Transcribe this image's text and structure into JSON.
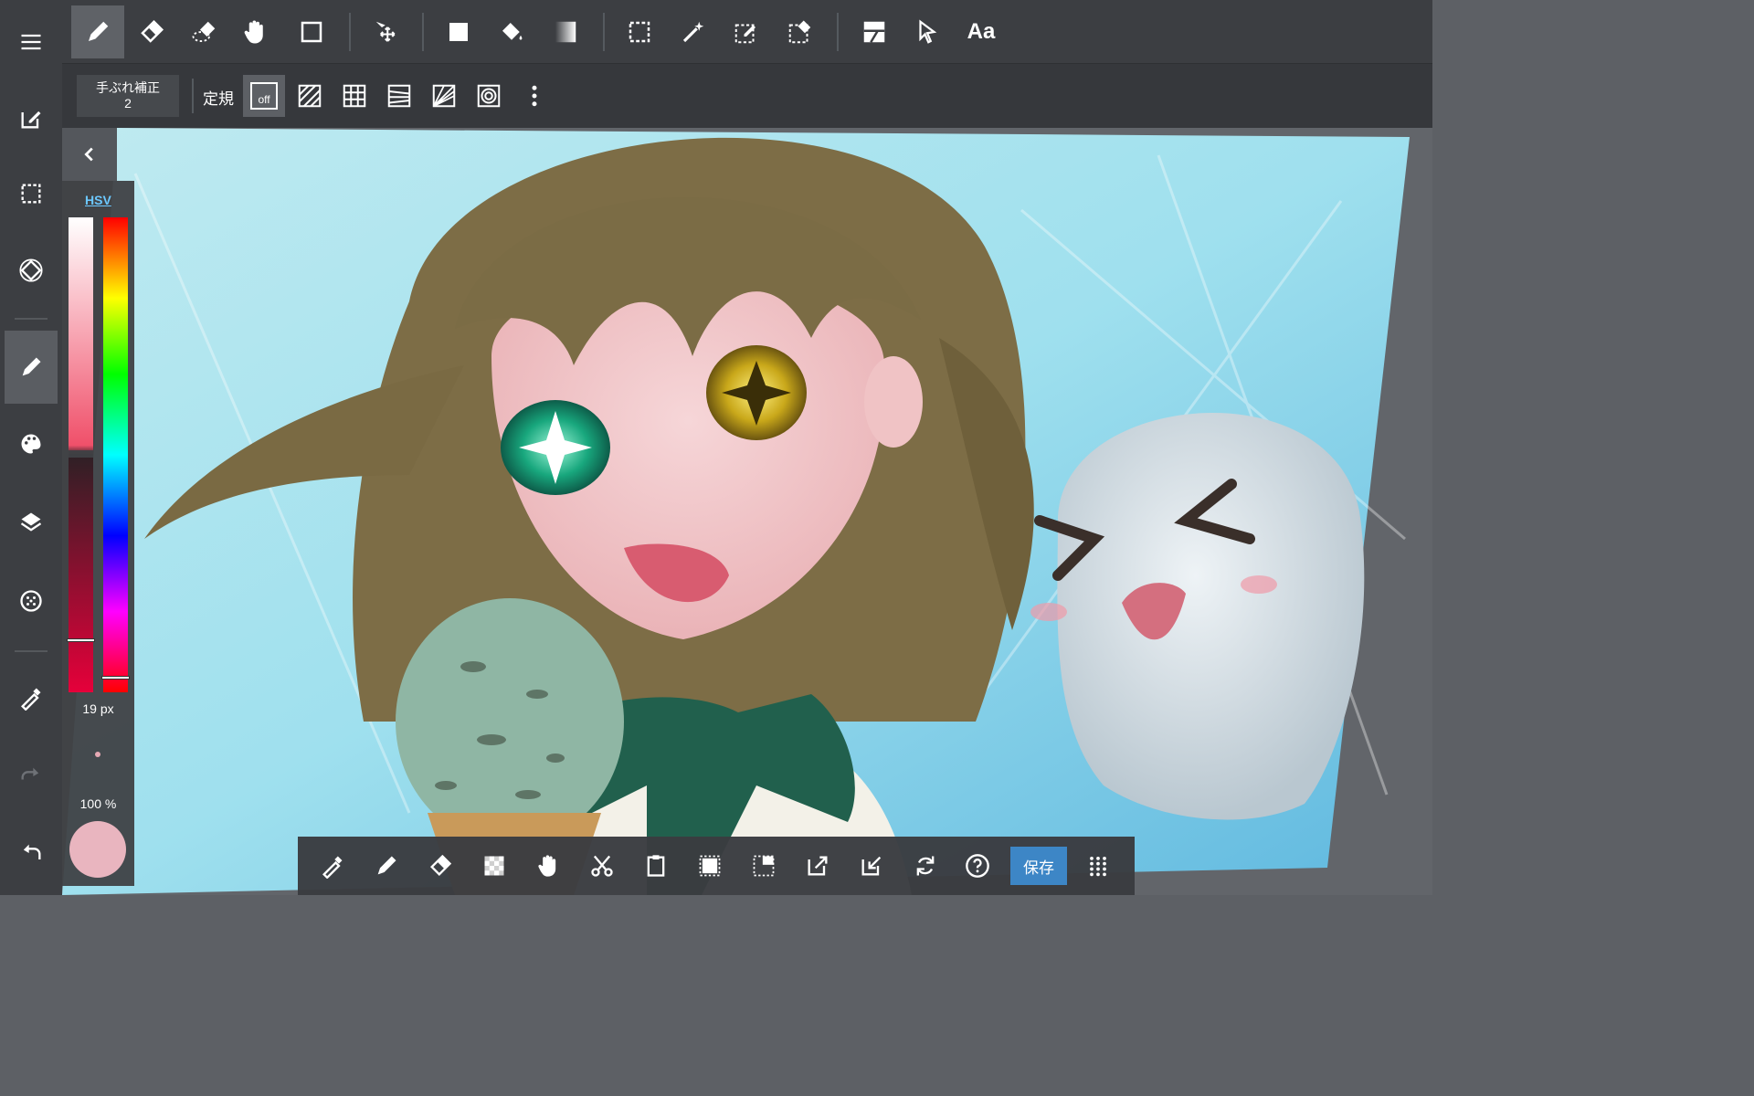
{
  "app": {
    "theme_colors": {
      "toolbar": "#3c3e42",
      "accent": "#3d86c6",
      "hsv_link": "#6cc8ff"
    }
  },
  "left_rail": {
    "items": [
      {
        "icon": "menu-icon"
      },
      {
        "icon": "edit-document-icon"
      },
      {
        "icon": "selection-icon"
      },
      {
        "icon": "rotate-canvas-icon"
      },
      {
        "icon": "pen-tool-icon",
        "active": true
      },
      {
        "icon": "palette-icon"
      },
      {
        "icon": "layers-icon"
      },
      {
        "icon": "materials-icon"
      },
      {
        "icon": "eyedropper-icon"
      },
      {
        "icon": "redo-icon",
        "disabled": true
      },
      {
        "icon": "undo-icon"
      }
    ]
  },
  "top_toolbar": {
    "tools": [
      {
        "icon": "pen-icon",
        "active": true
      },
      {
        "icon": "eraser-icon"
      },
      {
        "icon": "blur-icon"
      },
      {
        "icon": "hand-icon"
      },
      {
        "icon": "shape-icon"
      },
      {
        "icon": "move-icon"
      },
      {
        "icon": "fill-square-icon"
      },
      {
        "icon": "bucket-icon"
      },
      {
        "icon": "gradient-icon"
      },
      {
        "icon": "select-rect-icon"
      },
      {
        "icon": "magic-wand-icon"
      },
      {
        "icon": "select-pen-icon"
      },
      {
        "icon": "select-eraser-icon"
      },
      {
        "icon": "frame-divide-icon"
      },
      {
        "icon": "pointer-icon"
      }
    ],
    "text_tool_label": "Aa"
  },
  "sub_toolbar": {
    "stabilizer_label": "手ぶれ補正",
    "stabilizer_value": "2",
    "ruler_label": "定規",
    "ruler_off": "off",
    "rulers": [
      "parallel-ruler-icon",
      "grid-ruler-icon",
      "vertical-perspective-icon",
      "perspective-ruler-icon",
      "concentric-ruler-icon"
    ]
  },
  "color_panel": {
    "mode_label": "HSV",
    "brush_size": "19 px",
    "opacity": "100 %",
    "current_color": "#e9b5bf",
    "value_level": 0.89,
    "hue_level": 0.03
  },
  "bottom_toolbar": {
    "tools": [
      "eyedropper-icon",
      "pen-icon",
      "eraser-icon",
      "transparent-icon",
      "hand-icon",
      "cut-icon",
      "paste-icon",
      "select-all-icon",
      "deselect-icon",
      "export-icon",
      "import-icon",
      "rotate-icon",
      "help-icon"
    ],
    "save_label": "保存",
    "grid_icon": "dots-grid-icon"
  }
}
